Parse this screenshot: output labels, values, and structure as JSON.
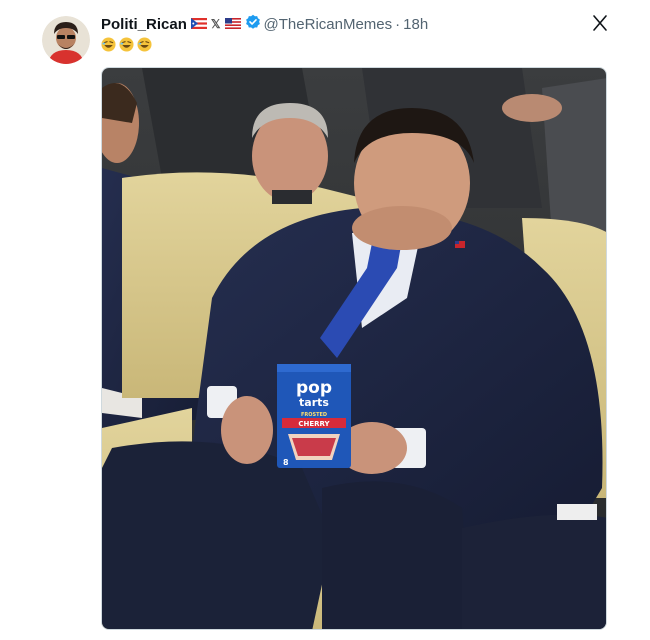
{
  "post": {
    "display_name": "Politi_Rican",
    "handle": "@TheRicanMemes",
    "separator": "·",
    "time": "18h",
    "badges": [
      "puerto-rico-flag-icon",
      "x-logo-icon",
      "us-flag-icon",
      "verified-badge-icon"
    ],
    "x_logo_text": "𝕏",
    "body_emojis": [
      "rofl-emoji",
      "rofl-emoji",
      "rofl-emoji"
    ],
    "close_icon": "close-icon"
  },
  "image": {
    "description_icon": "photo",
    "box": {
      "brand_line1": "pop",
      "brand_line2": "tarts",
      "flavor_small": "FROSTED",
      "flavor": "CHERRY",
      "count": "8"
    }
  },
  "colors": {
    "suit": "#1c2440",
    "tie": "#2b4bb3",
    "couch": "#d9c98f",
    "box_blue": "#1f57b8",
    "verified": "#1d9bf0"
  }
}
